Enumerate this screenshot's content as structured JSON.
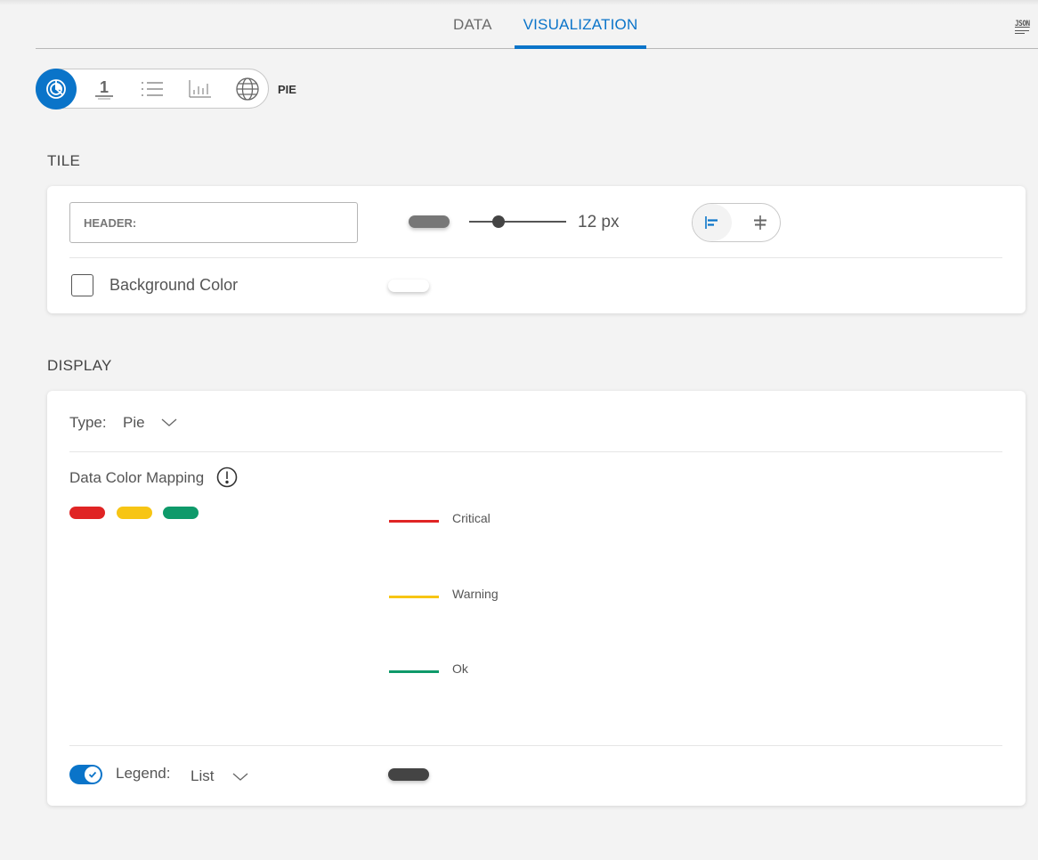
{
  "tabs": [
    {
      "label": "DATA",
      "active": false
    },
    {
      "label": "VISUALIZATION",
      "active": true
    }
  ],
  "json_button": {
    "label": "JSON",
    "icon": "json-icon"
  },
  "viz_selector": {
    "options": [
      {
        "icon": "pie-chart-icon",
        "active": true
      },
      {
        "icon": "single-value-icon",
        "glyph": "1",
        "active": false
      },
      {
        "icon": "list-icon",
        "active": false
      },
      {
        "icon": "bar-chart-icon",
        "active": false
      },
      {
        "icon": "globe-icon",
        "active": false
      }
    ],
    "selected_label": "PIE"
  },
  "tile": {
    "title": "TILE",
    "header_placeholder": "HEADER:",
    "header_value": "",
    "header_color": "#777777",
    "font_size_value": 12,
    "font_size_range": [
      0,
      40
    ],
    "font_size_label": "12 px",
    "alignment": {
      "options": [
        "left",
        "center"
      ],
      "selected": "left"
    },
    "background_color_label": "Background Color",
    "background_color_checked": false,
    "background_color": "#ffffff"
  },
  "display": {
    "title": "DISPLAY",
    "type_label": "Type:",
    "type_value": "Pie",
    "color_mapping_label": "Data Color Mapping",
    "swatches": [
      "#e02424",
      "#f7c514",
      "#0e9a6a"
    ],
    "legend_items": [
      {
        "label": "Critical",
        "color": "#e02424"
      },
      {
        "label": "Warning",
        "color": "#f7c514"
      },
      {
        "label": "Ok",
        "color": "#0e9a6a"
      }
    ],
    "legend_enabled": true,
    "legend_label": "Legend:",
    "legend_value": "List",
    "legend_color": "#444444"
  },
  "colors": {
    "accent": "#0a74c9"
  }
}
